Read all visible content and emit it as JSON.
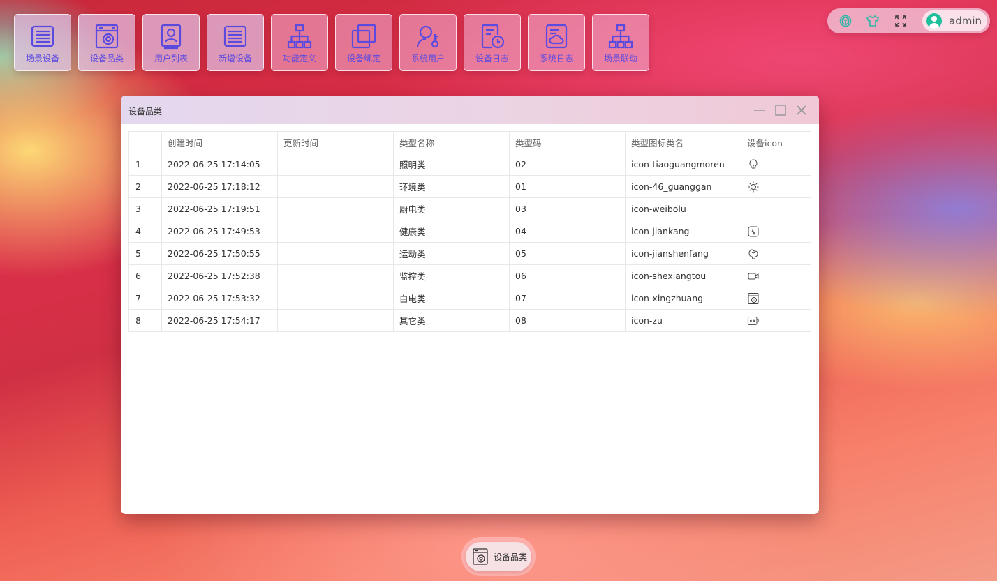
{
  "desktop": {
    "shortcuts": [
      {
        "label": "场景设备",
        "icon": "list-panel-icon"
      },
      {
        "label": "设备品类",
        "icon": "washing-machine-icon"
      },
      {
        "label": "用户列表",
        "icon": "user-card-icon"
      },
      {
        "label": "新增设备",
        "icon": "list-panel-icon"
      },
      {
        "label": "功能定义",
        "icon": "org-tree-icon"
      },
      {
        "label": "设备绑定",
        "icon": "copy-icon"
      },
      {
        "label": "系统用户",
        "icon": "user-key-icon"
      },
      {
        "label": "设备日志",
        "icon": "doc-clock-icon"
      },
      {
        "label": "系统日志",
        "icon": "doc-cloud-icon"
      },
      {
        "label": "场景联动",
        "icon": "org-tree-icon"
      }
    ]
  },
  "topbar": {
    "icons": [
      "cube-icon",
      "shirt-icon",
      "fullscreen-icon"
    ],
    "user_name": "admin"
  },
  "window": {
    "title": "设备品类",
    "columns": [
      "",
      "创建时间",
      "更新时间",
      "类型名称",
      "类型码",
      "类型图标类名",
      "设备icon"
    ],
    "rows": [
      {
        "idx": "1",
        "created": "2022-06-25 17:14:05",
        "updated": "",
        "name": "照明类",
        "code": "02",
        "icon_class": "icon-tiaoguangmoren",
        "icon": "bulb-icon"
      },
      {
        "idx": "2",
        "created": "2022-06-25 17:18:12",
        "updated": "",
        "name": "环境类",
        "code": "01",
        "icon_class": "icon-46_guanggan",
        "icon": "sun-icon"
      },
      {
        "idx": "3",
        "created": "2022-06-25 17:19:51",
        "updated": "",
        "name": "厨电类",
        "code": "03",
        "icon_class": "icon-weibolu",
        "icon": ""
      },
      {
        "idx": "4",
        "created": "2022-06-25 17:49:53",
        "updated": "",
        "name": "健康类",
        "code": "04",
        "icon_class": "icon-jiankang",
        "icon": "heart-rate-icon"
      },
      {
        "idx": "5",
        "created": "2022-06-25 17:50:55",
        "updated": "",
        "name": "运动类",
        "code": "05",
        "icon_class": "icon-jianshenfang",
        "icon": "muscle-icon"
      },
      {
        "idx": "6",
        "created": "2022-06-25 17:52:38",
        "updated": "",
        "name": "监控类",
        "code": "06",
        "icon_class": "icon-shexiangtou",
        "icon": "camera-icon"
      },
      {
        "idx": "7",
        "created": "2022-06-25 17:53:32",
        "updated": "",
        "name": "白电类",
        "code": "07",
        "icon_class": "icon-xingzhuang",
        "icon": "washing-machine-icon"
      },
      {
        "idx": "8",
        "created": "2022-06-25 17:54:17",
        "updated": "",
        "name": "其它类",
        "code": "08",
        "icon_class": "icon-zu",
        "icon": "socket-icon"
      }
    ]
  },
  "taskbar": {
    "items": [
      {
        "label": "设备品类",
        "icon": "washing-machine-icon"
      }
    ]
  },
  "colors": {
    "accent": "#5b4ae0",
    "avatar": "#1fbf9b",
    "topbar_icon_teal": "#2fb8a8"
  }
}
